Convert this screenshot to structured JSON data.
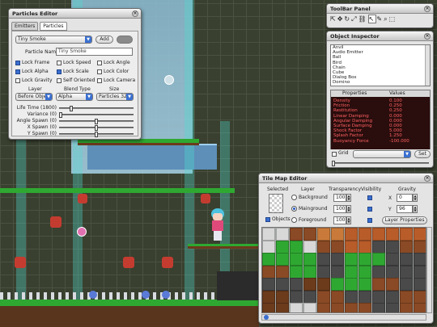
{
  "particles_editor": {
    "title": "Particles Editor",
    "tabs": [
      "Emitters",
      "Particles"
    ],
    "preset_value": "Tiny Smoke",
    "add_label": "Add",
    "particle_name_label": "Particle Name :",
    "particle_name_value": "Tiny Smoke",
    "checkboxes": [
      {
        "label": "Lock Frame",
        "checked": true
      },
      {
        "label": "Lock Speed",
        "checked": false
      },
      {
        "label": "Lock Angle",
        "checked": false
      },
      {
        "label": "Lock Alpha",
        "checked": true
      },
      {
        "label": "Lock Scale",
        "checked": true
      },
      {
        "label": "Lock Color",
        "checked": false
      },
      {
        "label": "Lock Gravity",
        "checked": false
      },
      {
        "label": "Self Oriented",
        "checked": false
      },
      {
        "label": "Lock Camera",
        "checked": false
      }
    ],
    "col_labels": [
      "Layer",
      "Blend Type",
      "Size"
    ],
    "layer_value": "Before Objec",
    "blend_value": "Alpha",
    "size_value": "Particles 32",
    "sliders": [
      {
        "label": "Life Time (1800)",
        "level": 0.15
      },
      {
        "label": "Variance (0)",
        "level": 0.0
      },
      {
        "label": "Angle Spawn (0)",
        "level": 0.5
      },
      {
        "label": "X Spawn (0)",
        "level": 0.5
      },
      {
        "label": "Y Spawn (0)",
        "level": 0.5
      }
    ]
  },
  "toolbar_panel": {
    "title": "ToolBar Panel"
  },
  "object_inspector": {
    "title": "Object Inspector",
    "list": [
      "Anvil",
      "Audio Emitter",
      "Ball",
      "Bird",
      "Chain",
      "Cube",
      "Dialog Box",
      "Domino"
    ],
    "prop_header": "Properties",
    "val_header": "Values",
    "props": [
      {
        "name": "Density",
        "value": "0.100"
      },
      {
        "name": "Friction",
        "value": "0.250"
      },
      {
        "name": "Restitution",
        "value": "0.250"
      },
      {
        "name": "Linear Damping",
        "value": "0.000"
      },
      {
        "name": "Angular Damping",
        "value": "0.000"
      },
      {
        "name": "Surface Damping",
        "value": "0.000"
      },
      {
        "name": "Shock Factor",
        "value": "5.000"
      },
      {
        "name": "Splash Factor",
        "value": "1.250"
      },
      {
        "name": "Buoyancy Force",
        "value": "-100.000"
      }
    ],
    "grid_label": "Grid",
    "set_label": "Set"
  },
  "tile_map_editor": {
    "title": "Tile Map Editor",
    "headers": [
      "Selected",
      "Layer",
      "Transparency",
      "Visibility",
      "Gravity"
    ],
    "layers": [
      {
        "label": "Background",
        "transparency": "100",
        "selected": false
      },
      {
        "label": "Mainground",
        "transparency": "100",
        "selected": true
      },
      {
        "label": "Foreground",
        "transparency": "100",
        "selected": false
      }
    ],
    "objects_label": "Objects",
    "gravity_x_label": "X",
    "gravity_x_value": "0",
    "gravity_y_label": "Y",
    "gravity_y_value": "96",
    "layer_props_label": "Layer Properties"
  },
  "colors": {
    "accent": "#3a6fd0",
    "grass": "#2fa832",
    "dirt": "#8a4a25",
    "inspector_bg": "#2a0d0d",
    "inspector_text": "#ff6060"
  }
}
